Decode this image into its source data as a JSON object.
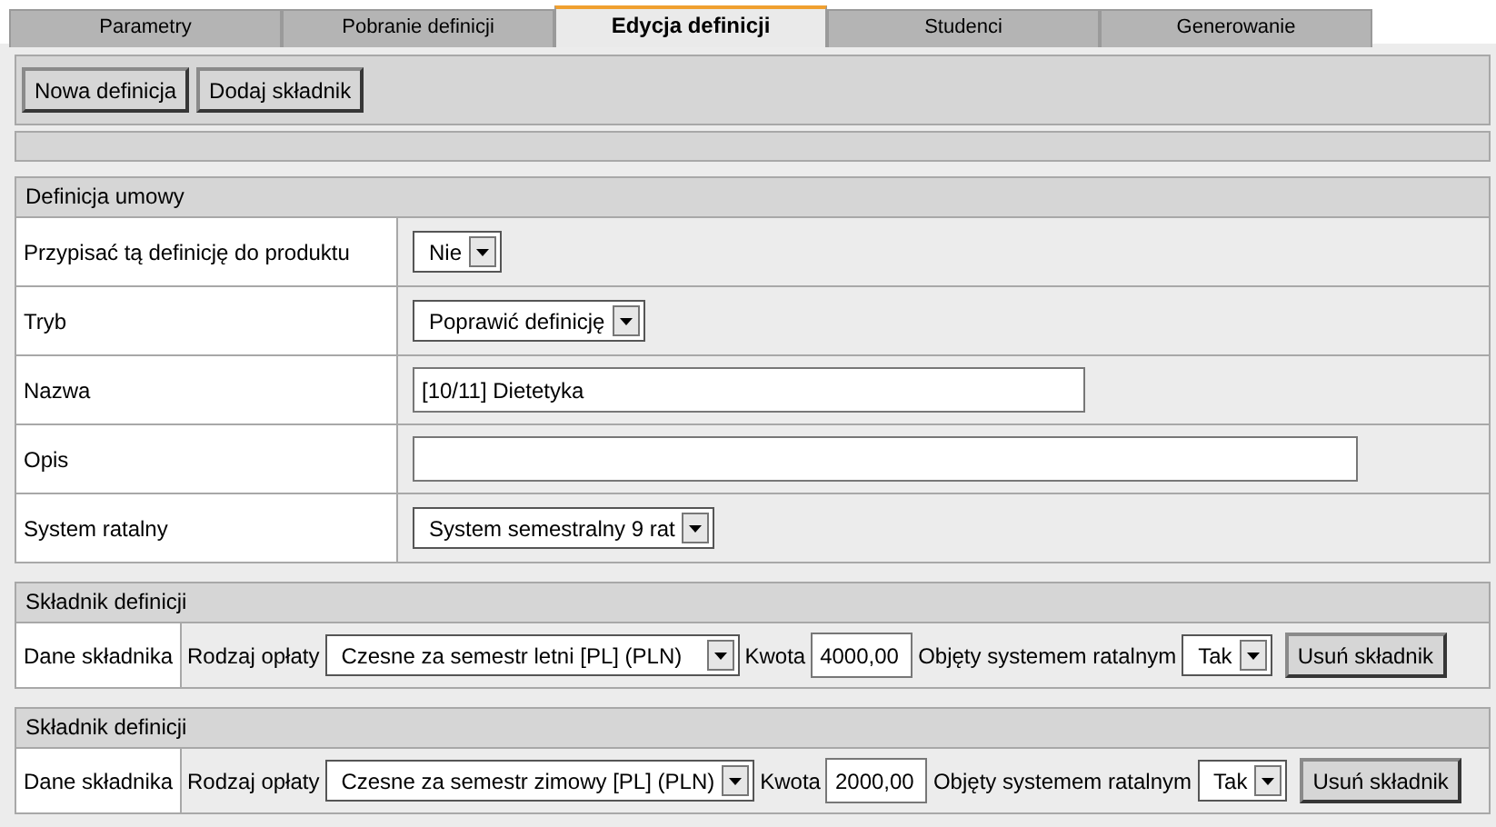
{
  "tabs": [
    {
      "label": "Parametry",
      "selected": false
    },
    {
      "label": "Pobranie definicji",
      "selected": false
    },
    {
      "label": "Edycja definicji",
      "selected": true
    },
    {
      "label": "Studenci",
      "selected": false
    },
    {
      "label": "Generowanie",
      "selected": false
    }
  ],
  "toolbar": {
    "buttons": [
      "Nowa definicja",
      "Dodaj składnik"
    ]
  },
  "definition": {
    "title": "Definicja umowy",
    "rows": [
      {
        "label": "Przypisać tą definicję do produktu",
        "kind": "select",
        "value": "Nie"
      },
      {
        "label": "Tryb",
        "kind": "select",
        "value": "Poprawić definicję"
      },
      {
        "label": "Nazwa",
        "kind": "text",
        "value": "[10/11] Dietetyka"
      },
      {
        "label": "Opis",
        "kind": "text",
        "value": ""
      },
      {
        "label": "System ratalny",
        "kind": "select",
        "value": "System semestralny 9 rat"
      }
    ]
  },
  "components": [
    {
      "title": "Składnik definicji",
      "label": "Dane składnika",
      "fee_label": "Rodzaj opłaty",
      "fee": "Czesne za semestr letni [PL] (PLN)",
      "amount_label": "Kwota",
      "amount": "4000,00",
      "installments_label": "Objęty systemem ratalnym",
      "installments": "Tak",
      "remove_button": "Usuń składnik"
    },
    {
      "title": "Składnik definicji",
      "label": "Dane składnika",
      "fee_label": "Rodzaj opłaty",
      "fee": "Czesne za semestr zimowy [PL] (PLN)",
      "amount_label": "Kwota",
      "amount": "2000,00",
      "installments_label": "Objęty systemem ratalnym",
      "installments": "Tak",
      "remove_button": "Usuń składnik"
    }
  ]
}
